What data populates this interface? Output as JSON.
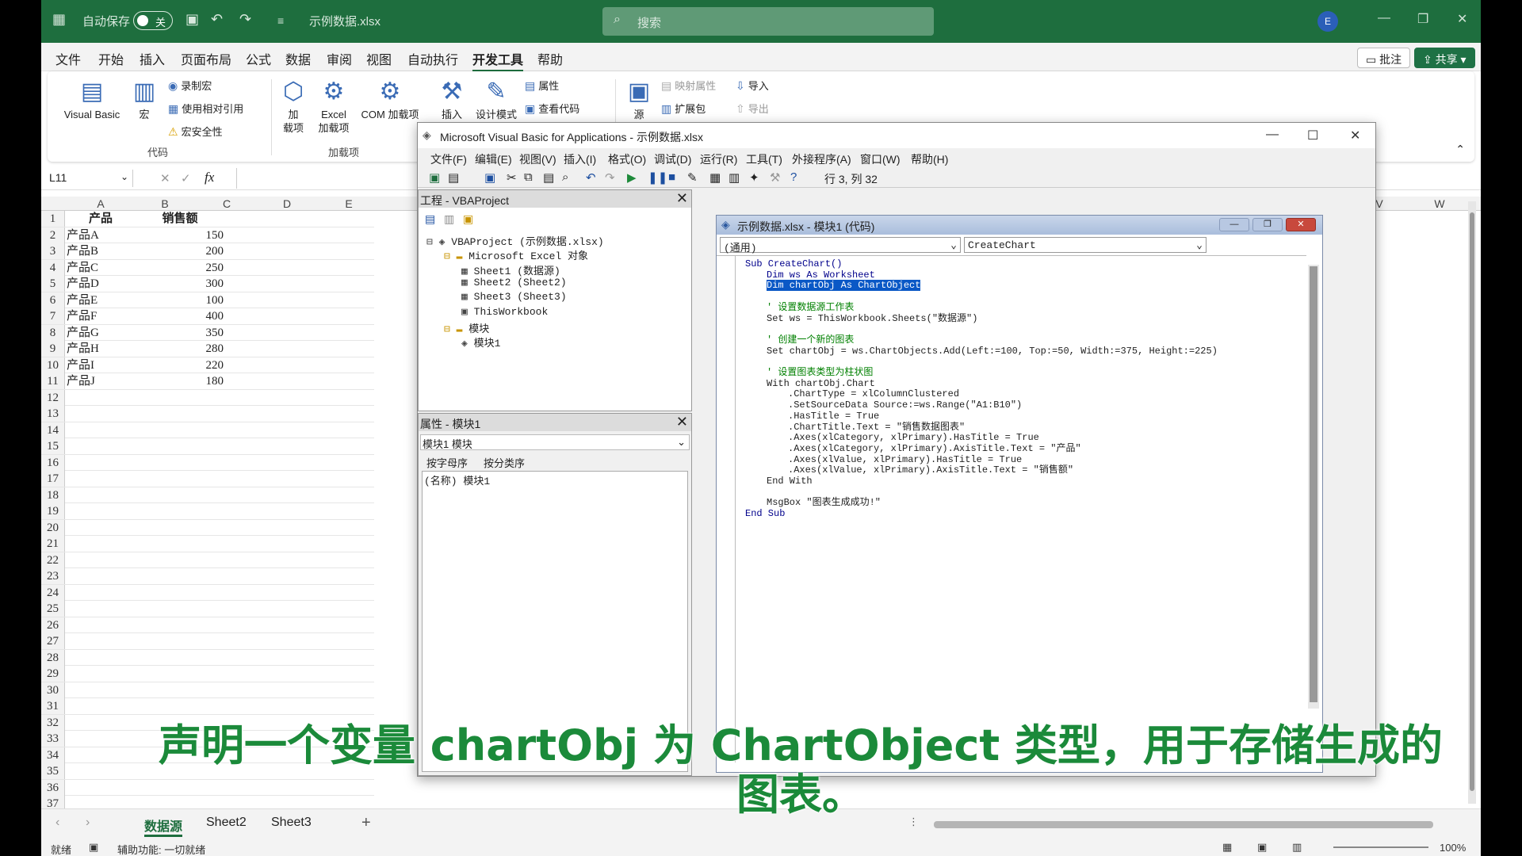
{
  "excel": {
    "autosave_label": "自动保存",
    "autosave_state": "关",
    "file_name": "示例数据.xlsx",
    "search_placeholder": "搜索",
    "user_initial": "E",
    "menu": [
      "文件",
      "开始",
      "插入",
      "页面布局",
      "公式",
      "数据",
      "审阅",
      "视图",
      "自动执行",
      "开发工具",
      "帮助"
    ],
    "active_menu": "开发工具",
    "comment_btn": "批注",
    "share_btn": "共享",
    "ribbon": {
      "visual_basic": "Visual Basic",
      "macro": "宏",
      "record_macro": "录制宏",
      "relative_ref": "使用相对引用",
      "macro_security": "宏安全性",
      "group_code": "代码",
      "addins": "加\n载项",
      "excel_addins": "Excel\n加载项",
      "com_addins": "COM 加载项",
      "group_addins": "加载项",
      "insert": "插入",
      "design_mode": "设计模式",
      "properties": "属性",
      "view_code": "查看代码",
      "source": "源",
      "map_props": "映射属性",
      "ext_pack": "扩展包",
      "import": "导入",
      "export": "导出"
    },
    "name_box": "L11",
    "fx": "fx",
    "columns": [
      "A",
      "B",
      "C",
      "D",
      "E",
      "V",
      "W"
    ],
    "header_row": [
      "产品",
      "销售额"
    ],
    "data_rows": [
      [
        "产品A",
        "150"
      ],
      [
        "产品B",
        "200"
      ],
      [
        "产品C",
        "250"
      ],
      [
        "产品D",
        "300"
      ],
      [
        "产品E",
        "100"
      ],
      [
        "产品F",
        "400"
      ],
      [
        "产品G",
        "350"
      ],
      [
        "产品H",
        "280"
      ],
      [
        "产品I",
        "220"
      ],
      [
        "产品J",
        "180"
      ]
    ],
    "row_count": 37,
    "sheets": [
      "数据源",
      "Sheet2",
      "Sheet3"
    ],
    "active_sheet": "数据源",
    "status_ready": "就绪",
    "accessibility": "辅助功能: 一切就绪",
    "zoom": "100%"
  },
  "vbe": {
    "title": "Microsoft Visual Basic for Applications - 示例数据.xlsx",
    "menu": [
      "文件(F)",
      "编辑(E)",
      "视图(V)",
      "插入(I)",
      "格式(O)",
      "调试(D)",
      "运行(R)",
      "工具(T)",
      "外接程序(A)",
      "窗口(W)",
      "帮助(H)"
    ],
    "cursor_pos": "行 3, 列 32",
    "project_title": "工程 - VBAProject",
    "tree": [
      {
        "indent": 0,
        "icon": "vba-project-icon",
        "text": "VBAProject (示例数据.xlsx)"
      },
      {
        "indent": 1,
        "icon": "folder-icon",
        "text": "Microsoft Excel 对象"
      },
      {
        "indent": 2,
        "icon": "sheet-icon",
        "text": "Sheet1 (数据源)"
      },
      {
        "indent": 2,
        "icon": "sheet-icon",
        "text": "Sheet2 (Sheet2)"
      },
      {
        "indent": 2,
        "icon": "sheet-icon",
        "text": "Sheet3 (Sheet3)"
      },
      {
        "indent": 2,
        "icon": "workbook-icon",
        "text": "ThisWorkbook"
      },
      {
        "indent": 1,
        "icon": "folder-icon",
        "text": "模块"
      },
      {
        "indent": 2,
        "icon": "module-icon",
        "text": "模块1"
      }
    ],
    "props_title": "属性 - 模块1",
    "props_combo": "模块1 模块",
    "props_tab_alpha": "按字母序",
    "props_tab_cat": "按分类序",
    "props_row": "(名称) 模块1",
    "code_title": "示例数据.xlsx - 模块1 (代码)",
    "object_combo": "(通用)",
    "proc_combo": "CreateChart",
    "code": [
      {
        "t": "Sub CreateChart()",
        "k": "kw",
        "i": 0
      },
      {
        "t": "Dim ws As Worksheet",
        "k": "kw",
        "i": 1
      },
      {
        "t": "Dim chartObj As ChartObject",
        "k": "hl",
        "i": 1
      },
      {
        "t": "",
        "k": "",
        "i": 0
      },
      {
        "t": "' 设置数据源工作表",
        "k": "cm",
        "i": 1
      },
      {
        "t": "Set ws = ThisWorkbook.Sheets(\"数据源\")",
        "k": "",
        "i": 1
      },
      {
        "t": "",
        "k": "",
        "i": 0
      },
      {
        "t": "' 创建一个新的图表",
        "k": "cm",
        "i": 1
      },
      {
        "t": "Set chartObj = ws.ChartObjects.Add(Left:=100, Top:=50, Width:=375, Height:=225)",
        "k": "",
        "i": 1
      },
      {
        "t": "",
        "k": "",
        "i": 0
      },
      {
        "t": "' 设置图表类型为柱状图",
        "k": "cm",
        "i": 1
      },
      {
        "t": "With chartObj.Chart",
        "k": "",
        "i": 1
      },
      {
        "t": ".ChartType = xlColumnClustered",
        "k": "",
        "i": 2
      },
      {
        "t": ".SetSourceData Source:=ws.Range(\"A1:B10\")",
        "k": "",
        "i": 2
      },
      {
        "t": ".HasTitle = True",
        "k": "",
        "i": 2
      },
      {
        "t": ".ChartTitle.Text = \"销售数据图表\"",
        "k": "",
        "i": 2
      },
      {
        "t": ".Axes(xlCategory, xlPrimary).HasTitle = True",
        "k": "",
        "i": 2
      },
      {
        "t": ".Axes(xlCategory, xlPrimary).AxisTitle.Text = \"产品\"",
        "k": "",
        "i": 2
      },
      {
        "t": ".Axes(xlValue, xlPrimary).HasTitle = True",
        "k": "",
        "i": 2
      },
      {
        "t": ".Axes(xlValue, xlPrimary).AxisTitle.Text = \"销售额\"",
        "k": "",
        "i": 2
      },
      {
        "t": "End With",
        "k": "",
        "i": 1
      },
      {
        "t": "",
        "k": "",
        "i": 0
      },
      {
        "t": "MsgBox \"图表生成成功!\"",
        "k": "",
        "i": 1
      },
      {
        "t": "End Sub",
        "k": "kw",
        "i": 0
      }
    ]
  },
  "subtitle": "声明一个变量 chartObj 为 ChartObject 类型，用于存储生成的\n图表。"
}
